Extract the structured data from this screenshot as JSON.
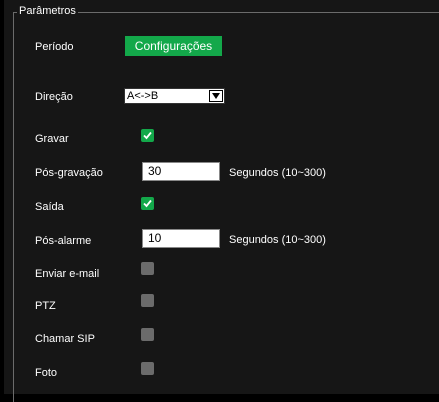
{
  "fieldset": {
    "legend": "Parâmetros"
  },
  "periodo": {
    "label": "Período",
    "button_label": "Configurações"
  },
  "direcao": {
    "label": "Direção",
    "selected": "A<->B"
  },
  "gravar": {
    "label": "Gravar",
    "checked": true
  },
  "pos_gravacao": {
    "label": "Pós-gravação",
    "value": "30",
    "unit": "Segundos (10~300)"
  },
  "saida": {
    "label": "Saída",
    "checked": true
  },
  "pos_alarme": {
    "label": "Pós-alarme",
    "value": "10",
    "unit": "Segundos (10~300)"
  },
  "enviar_email": {
    "label": "Enviar e-mail",
    "checked": false
  },
  "ptz": {
    "label": "PTZ",
    "checked": false
  },
  "chamar_sip": {
    "label": "Chamar SIP",
    "checked": false
  },
  "foto": {
    "label": "Foto",
    "checked": false
  },
  "colors": {
    "accent": "#13a84a",
    "background": "#161616",
    "unchecked": "#6b6b6b"
  }
}
